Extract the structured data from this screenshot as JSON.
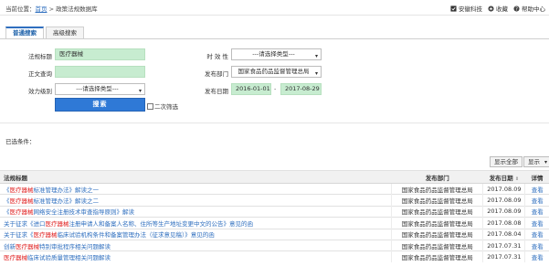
{
  "breadcrumb": {
    "prefix": "当前位置：",
    "home": "首页",
    "separator": " > ",
    "current": "政策法规数据库"
  },
  "toolbar": {
    "favorite": "安徽科技",
    "collect": "收藏",
    "help": "帮助中心"
  },
  "tabs": [
    {
      "label": "普通搜索",
      "active": true
    },
    {
      "label": "高级搜索",
      "active": false
    }
  ],
  "form": {
    "title_label": "法规标题",
    "title_value": "医疗器械",
    "body_label": "正文查询",
    "body_value": "",
    "level_label": "效力级别",
    "level_value": "---请选择类型---",
    "validity_label": "时  效  性",
    "validity_value": "---请选择类型---",
    "dept_label": "发布部门",
    "dept_value": "国家食品药品监督管理总局",
    "date_label": "发布日期",
    "date_from": "2016-01-01",
    "date_to": "2017-08-29",
    "search_button": "搜索",
    "second_search": "二次筛选"
  },
  "selected_conditions": "已选条件：",
  "buttons": {
    "show_all": "显示全部",
    "display": "显示"
  },
  "table": {
    "headers": {
      "title": "法规标题",
      "dept": "发布部门",
      "date": "发布日期",
      "detail": "详情"
    },
    "rows": [
      {
        "p1": "《",
        "kw": "医疗器械",
        "p2": "标准管理办法》解读之一",
        "dept": "国家食品药品监督管理总局",
        "date": "2017.08.09",
        "op": "查看"
      },
      {
        "p1": "《",
        "kw": "医疗器械",
        "p2": "标准管理办法》解读之二",
        "dept": "国家食品药品监督管理总局",
        "date": "2017.08.09",
        "op": "查看"
      },
      {
        "p1": "《",
        "kw": "医疗器械",
        "p2": "网络安全注册技术审查指导原则》解读",
        "dept": "国家食品药品监督管理总局",
        "date": "2017.08.09",
        "op": "查看"
      },
      {
        "p1": "关于征求《进口",
        "kw": "医疗器械",
        "p2": "注册申请人和备案人名称、住所等生产地址变更中文的公告》意见的函",
        "dept": "国家食品药品监督管理总局",
        "date": "2017.08.08",
        "op": "查看"
      },
      {
        "p1": "关于征求《",
        "kw": "医疗器械",
        "p2": "临床试验机构条件和备案管理办法（征求意见稿）》意见的函",
        "dept": "国家食品药品监督管理总局",
        "date": "2017.08.04",
        "op": "查看"
      },
      {
        "p1": "创新",
        "kw": "医疗器械",
        "p2": "特别审批程序相关问题解读",
        "dept": "国家食品药品监督管理总局",
        "date": "2017.07.31",
        "op": "查看"
      },
      {
        "p1": "",
        "kw": "医疗器械",
        "p2": "临床试验质量管理相关问题解读",
        "dept": "国家食品药品监督管理总局",
        "date": "2017.07.31",
        "op": "查看"
      }
    ]
  },
  "colors": {
    "link": "#2f6fbf",
    "keyword": "#e02020",
    "search_button": "#2f79d6",
    "input_highlight": "#c7ecd0"
  }
}
